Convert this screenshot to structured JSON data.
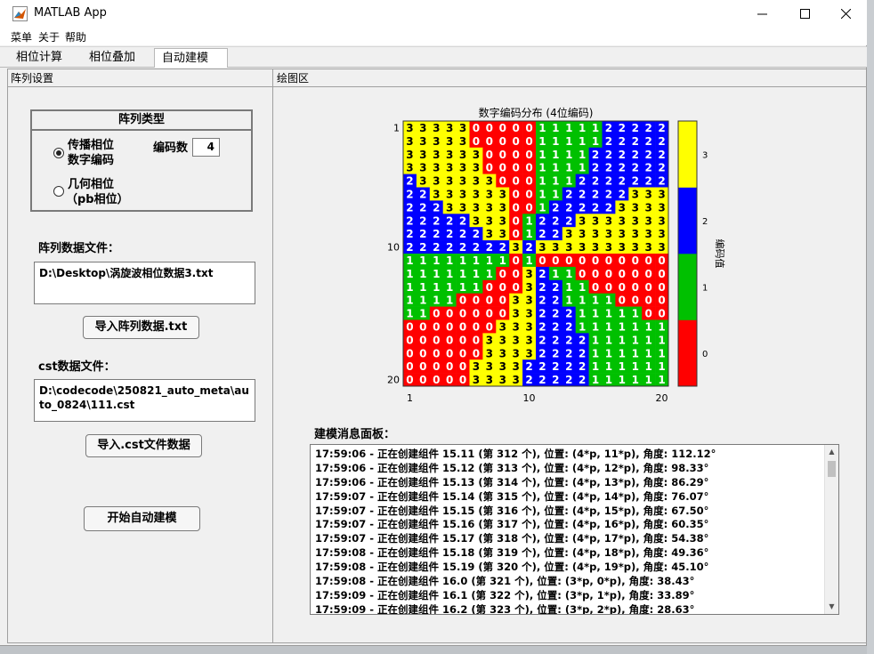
{
  "window": {
    "title": "MATLAB App"
  },
  "menu": [
    "菜单",
    "关于",
    "帮助"
  ],
  "tabs": [
    {
      "label": "相位计算",
      "active": false
    },
    {
      "label": "相位叠加",
      "active": false
    },
    {
      "label": "自动建模",
      "active": true
    }
  ],
  "left_panel": {
    "title": "阵列设置",
    "array_type": {
      "title": "阵列类型",
      "option1_line1": "传播相位",
      "option1_line2": "数字编码",
      "option2_line1": "几何相位",
      "option2_line2": "（pb相位）",
      "selected": "option1"
    },
    "code_count_label": "编码数",
    "code_count_value": "4",
    "array_file_label": "阵列数据文件：",
    "array_file_value": "D:\\Desktop\\涡旋波相位数据3.txt",
    "import_array_button": "导入阵列数据.txt",
    "cst_file_label": "cst数据文件：",
    "cst_file_value": "D:\\codecode\\250821_auto_meta\\auto_0824\\111.cst",
    "import_cst_button": "导入.cst文件数据",
    "start_button": "开始自动建模"
  },
  "right_panel": {
    "title": "绘图区",
    "message_panel_title": "建模消息面板：",
    "messages": [
      "17:59:06 - 正在创建组件 15.11 (第 312 个), 位置: (4*p, 11*p), 角度: 112.12°",
      "17:59:06 - 正在创建组件 15.12 (第 313 个), 位置: (4*p, 12*p), 角度: 98.33°",
      "17:59:06 - 正在创建组件 15.13 (第 314 个), 位置: (4*p, 13*p), 角度: 86.29°",
      "17:59:07 - 正在创建组件 15.14 (第 315 个), 位置: (4*p, 14*p), 角度: 76.07°",
      "17:59:07 - 正在创建组件 15.15 (第 316 个), 位置: (4*p, 15*p), 角度: 67.50°",
      "17:59:07 - 正在创建组件 15.16 (第 317 个), 位置: (4*p, 16*p), 角度: 60.35°",
      "17:59:07 - 正在创建组件 15.17 (第 318 个), 位置: (4*p, 17*p), 角度: 54.38°",
      "17:59:08 - 正在创建组件 15.18 (第 319 个), 位置: (4*p, 18*p), 角度: 49.36°",
      "17:59:08 - 正在创建组件 15.19 (第 320 个), 位置: (4*p, 19*p), 角度: 45.10°",
      "17:59:08 - 正在创建组件 16.0 (第 321 个), 位置: (3*p, 0*p), 角度: 38.43°",
      "17:59:09 - 正在创建组件 16.1 (第 322 个), 位置: (3*p, 1*p), 角度: 33.89°",
      "17:59:09 - 正在创建组件 16.2 (第 323 个), 位置: (3*p, 2*p), 角度: 28.63°"
    ]
  },
  "chart_data": {
    "type": "heatmap",
    "title": "数字编码分布 (4位编码)",
    "x_ticks": [
      "1",
      "10",
      "20"
    ],
    "y_ticks": [
      "1",
      "10",
      "20"
    ],
    "xlim": [
      1,
      20
    ],
    "ylim": [
      1,
      20
    ],
    "colorbar_label": "编码值",
    "colorbar_ticks": [
      "0",
      "1",
      "2",
      "3"
    ],
    "colors": [
      "#ff0000",
      "#00c000",
      "#0000ff",
      "#ffff00"
    ],
    "text_colors": [
      "#ffffff",
      "#ffffff",
      "#ffffff",
      "#000000"
    ],
    "grid": [
      "33333000001111122222",
      "33333000001111122222",
      "33333300001111222222",
      "33333300001111222222",
      "23333330001112222222",
      "22333333001122222333",
      "22233333001222223333",
      "22222333012223333333",
      "22222233012233333333",
      "22222222323333333333",
      "11111111010000000000",
      "11111110032110000000",
      "11111100032211000000",
      "11110000332211110000",
      "11000000332221111100",
      "00000003332221111111",
      "00000033332222111111",
      "00000033332222111111",
      "00000333322222111111",
      "00000333322222111111"
    ]
  }
}
